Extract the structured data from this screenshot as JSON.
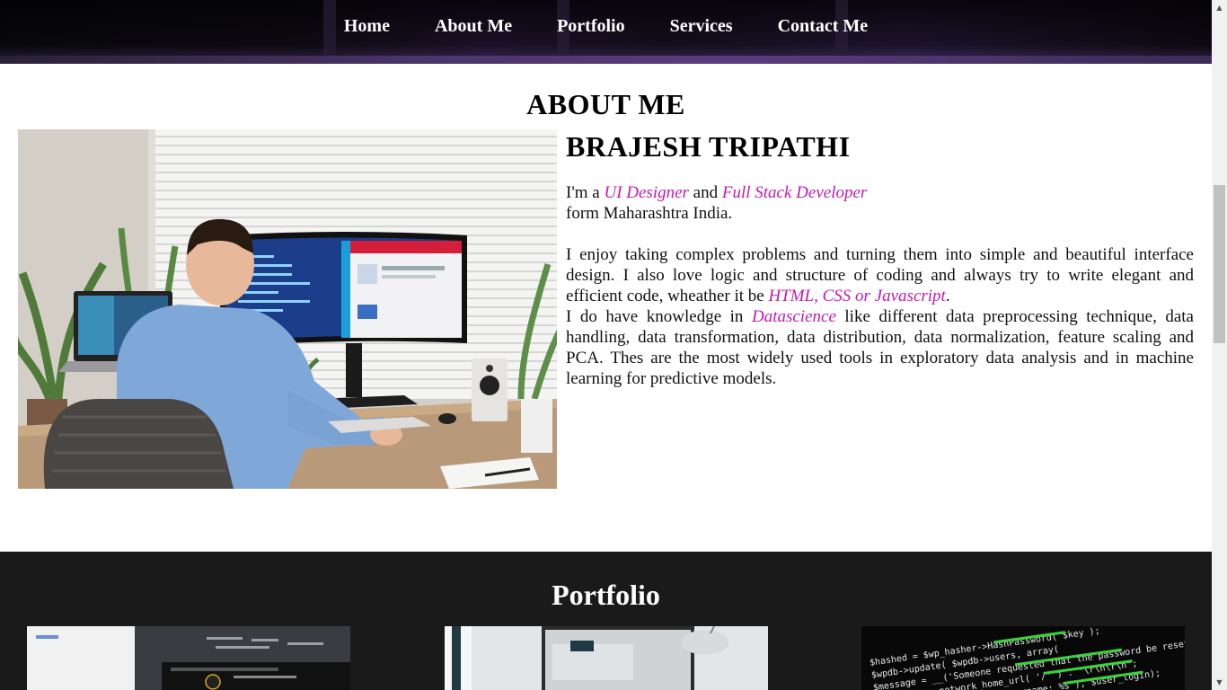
{
  "nav": {
    "items": [
      {
        "label": "Home"
      },
      {
        "label": "About Me"
      },
      {
        "label": "Portfolio"
      },
      {
        "label": "Services"
      },
      {
        "label": "Contact Me"
      }
    ]
  },
  "about": {
    "title": "ABOUT ME",
    "name": "BRAJESH TRIPATHI",
    "intro_prefix": "I'm a ",
    "role1": "UI Designer",
    "intro_and": " and ",
    "role2": "Full Stack Developer",
    "intro_location": "form Maharashtra India.",
    "para1_text": "I enjoy taking complex problems and turning them into simple and beautiful interface design. I also love logic and structure of coding and always try to write elegant and efficient code, wheather it be ",
    "para1_highlight": "HTML, CSS or Javascript",
    "para1_end": ".",
    "para2_prefix": "I do have knowledge in ",
    "para2_highlight": "Datascience",
    "para2_text": " like different data preprocessing technique, data handling, data transformation, data distribution, data normalization, feature scaling and PCA. Thes are the most widely used tools in exploratory data analysis and in machine learning for predictive models."
  },
  "portfolio": {
    "title": "Portfolio"
  },
  "colors": {
    "accent": "#c01ab0",
    "portfolio_bg": "#1a1a1a"
  }
}
